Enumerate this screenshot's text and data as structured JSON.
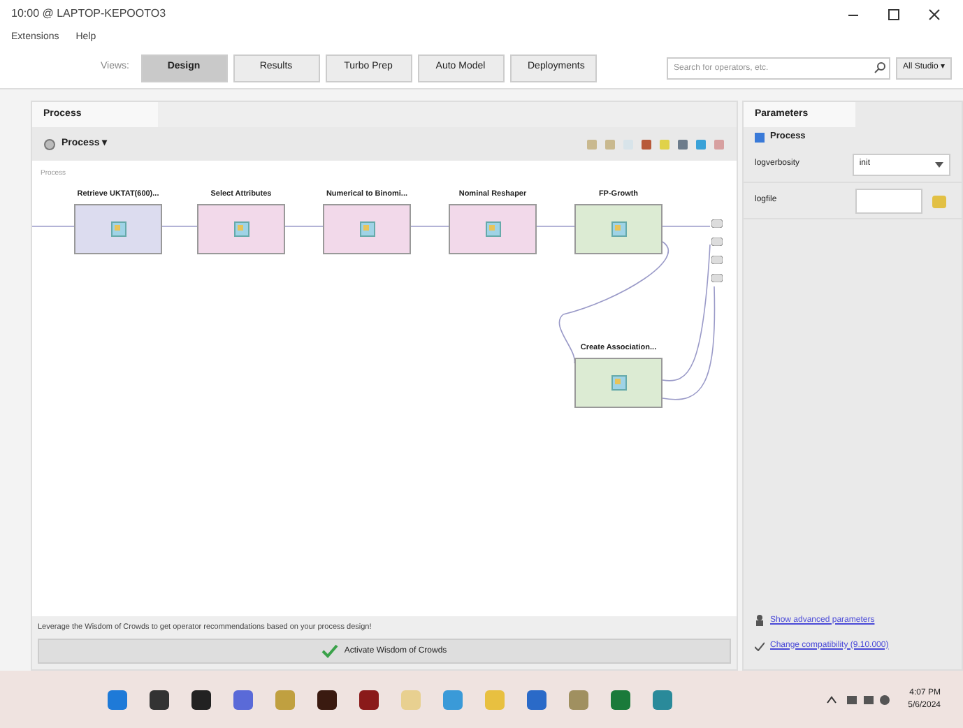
{
  "window": {
    "title": "10:00 @ LAPTOP-KEPOOTO3"
  },
  "menu": [
    "Extensions",
    "Help"
  ],
  "views": {
    "label": "Views:",
    "tabs": [
      {
        "label": "Design",
        "selected": true
      },
      {
        "label": "Results",
        "selected": false
      },
      {
        "label": "Turbo Prep",
        "selected": false
      },
      {
        "label": "Auto Model",
        "selected": false
      },
      {
        "label": "Deployments",
        "selected": false
      }
    ]
  },
  "search": {
    "placeholder": "Search for operators, etc."
  },
  "studio_menu": "All Studio ▾",
  "process_panel": {
    "tab": "Process",
    "breadcrumb": "Process ▾",
    "canvas_label": "Process",
    "operators": [
      {
        "label": "Retrieve UKTAT(600)...",
        "color": "#dcdcef"
      },
      {
        "label": "Select Attributes",
        "color": "#f2d9ea"
      },
      {
        "label": "Numerical to Binomi...",
        "color": "#f2d9ea"
      },
      {
        "label": "Nominal Reshaper",
        "color": "#f2d9ea"
      },
      {
        "label": "FP-Growth",
        "color": "#dcebd3"
      },
      {
        "label": "Create Association...",
        "color": "#dcebd3"
      }
    ],
    "hint": "Leverage the Wisdom of Crowds to get operator recommendations based on your process design!",
    "activate_button": "Activate Wisdom of Crowds"
  },
  "parameters_panel": {
    "tab": "Parameters",
    "process_label": "Process",
    "fields": [
      {
        "kind": "select",
        "label": "logverbosity",
        "value": "init"
      },
      {
        "kind": "file",
        "label": "logfile"
      }
    ],
    "links": [
      "Show advanced parameters",
      "Change compatibility (9.10.000)"
    ]
  },
  "taskbar": {
    "time": "4:07 PM",
    "date": "5/6/2024"
  }
}
